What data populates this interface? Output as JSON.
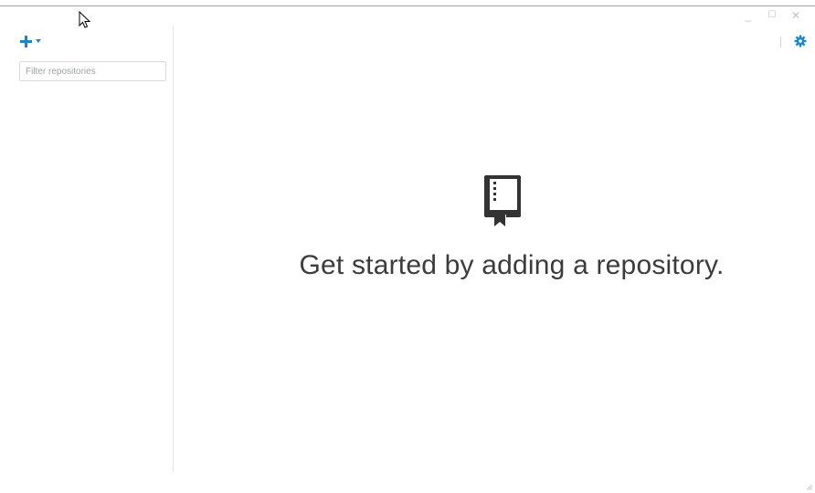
{
  "window": {
    "controls": {
      "minimize": "_",
      "maximize": "☐",
      "close": "✕"
    }
  },
  "sidebar": {
    "add_button": {
      "plus_icon": "plus-icon",
      "caret_icon": "caret-down-icon"
    },
    "filter": {
      "placeholder": "Filter repositories",
      "value": ""
    }
  },
  "toolbar": {
    "settings_icon": "gear-icon"
  },
  "blank_slate": {
    "icon": "repo-book-icon",
    "message": "Get started by adding a repository."
  },
  "colors": {
    "accent": "#1a86c6",
    "icon_dark": "#333333",
    "text": "#3c3c3c"
  }
}
